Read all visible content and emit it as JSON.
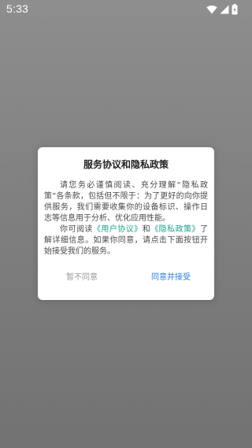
{
  "status_bar": {
    "time": "5:33",
    "icons": [
      "wifi-icon",
      "signal-icon",
      "battery-icon"
    ]
  },
  "dialog": {
    "title": "服务协议和隐私政策",
    "paragraph1": "请您务必谨慎阅读、充分理解“隐私政策”各条款，包括但不限于：为了更好的向你提供服务，我们需要收集你的设备标识、操作日志等信息用于分析、优化应用性能。",
    "paragraph2_prefix": "你可阅读",
    "user_agreement_link": "《用户协议》",
    "paragraph2_and": "和",
    "privacy_policy_link": "《隐私政策》",
    "paragraph2_suffix": "了解详细信息。如果你同意，请点击下面按钮开始接受我们的服务。",
    "decline_label": "暂不同意",
    "accept_label": "同意并接受"
  },
  "colors": {
    "overlay": "#808080",
    "link": "#1aa38d",
    "accept": "#2f7de1",
    "decline": "#9a9a9a"
  }
}
